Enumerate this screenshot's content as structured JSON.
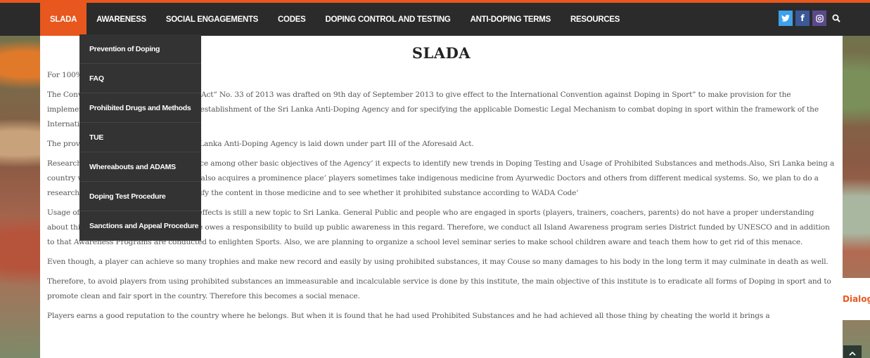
{
  "nav": {
    "items": [
      {
        "label": "SLADA",
        "active": true
      },
      {
        "label": "AWARENESS",
        "active": false
      },
      {
        "label": "SOCIAL ENGAGEMENTS",
        "active": false
      },
      {
        "label": "CODES",
        "active": false
      },
      {
        "label": "DOPING CONTROL AND TESTING",
        "active": false
      },
      {
        "label": "ANTI-DOPING TERMS",
        "active": false
      },
      {
        "label": "RESOURCES",
        "active": false
      }
    ]
  },
  "social": {
    "twitter": "twitter-icon",
    "facebook": "facebook-icon",
    "instagram": "instagram-icon",
    "search": "search-icon"
  },
  "dropdown": {
    "items": [
      "Prevention of Doping",
      "FAQ",
      "Prohibited Drugs and Methods",
      "TUE",
      "Whereabouts and ADAMS",
      "Doping Test Procedure",
      "Sanctions and Appeal Procedure"
    ]
  },
  "page": {
    "title": "SLADA",
    "paragraphs": [
      "For 100% Clean Sports",
      "The Convention against Doping in Sports Act” No. 33 of 2013 was drafted on 9th day of September 2013 to give effect to the International Convention against Doping in Sport” to make provision for the implementation of the Convention by the establishment of the Sri Lanka Anti-Doping Agency and for specifying the applicable Domestic Legal Mechanism to combat doping in sport within the framework of the International Convention.",
      "The provision of the establishment of Sri Lanka Anti-Doping Agency is laid down under part III of the Aforesaid Act.",
      "Research has been given a prominent place among other basic objectives of the Agency’ it expects to identify new trends in Doping Testing and Usage of Prohibited Substances and methods.Also, Sri Lanka being a country where such indigenous medicine also acquires a prominence place’ players sometimes take indigenous medicine from Ayurwedic Doctors and others from different medical systems. So, we plan to do a research on indigenous medicine to identify the content in those medicine and to see whether it prohibited substance according to WADA Code’",
      "Usage of prohibited substance and its ill effects is still a new topic to Sri Lanka. General Public and people who are engaged in sports (players, trainers, coachers, parents) do not have a proper understanding about this matter. As a result this institute owes a responsibility to build up public awareness in this regard. Therefore, we conduct all Island Awareness program series District funded by UNESCO and in addition to that Awareness Programs are conducted to enlighten Sports. Also, we are planning to organize a school level seminar series to make school children aware and teach them how to get rid of this menace.",
      "Even though, a player can achieve so many trophies and make new record and easily by using prohibited substances, it may Couse so many damages to his body in the long term it may culminate in death as well.",
      "Therefore, to avoid players from using prohibited substances an immeasurable and incalculable service is done by this institute, the main objective of this institute is to eradicate all forms of Doping in sport and to promote clean and fair sport in the country. Therefore this becomes a social menace.",
      "Players earns a good reputation to the country where he belongs. But when it is found that he had used Prohibited Substances and he had achieved all those thing by cheating the world it brings a"
    ]
  },
  "sponsor": {
    "text": "Dialog"
  },
  "scroll_top": {
    "icon": "chevron-up-icon"
  }
}
